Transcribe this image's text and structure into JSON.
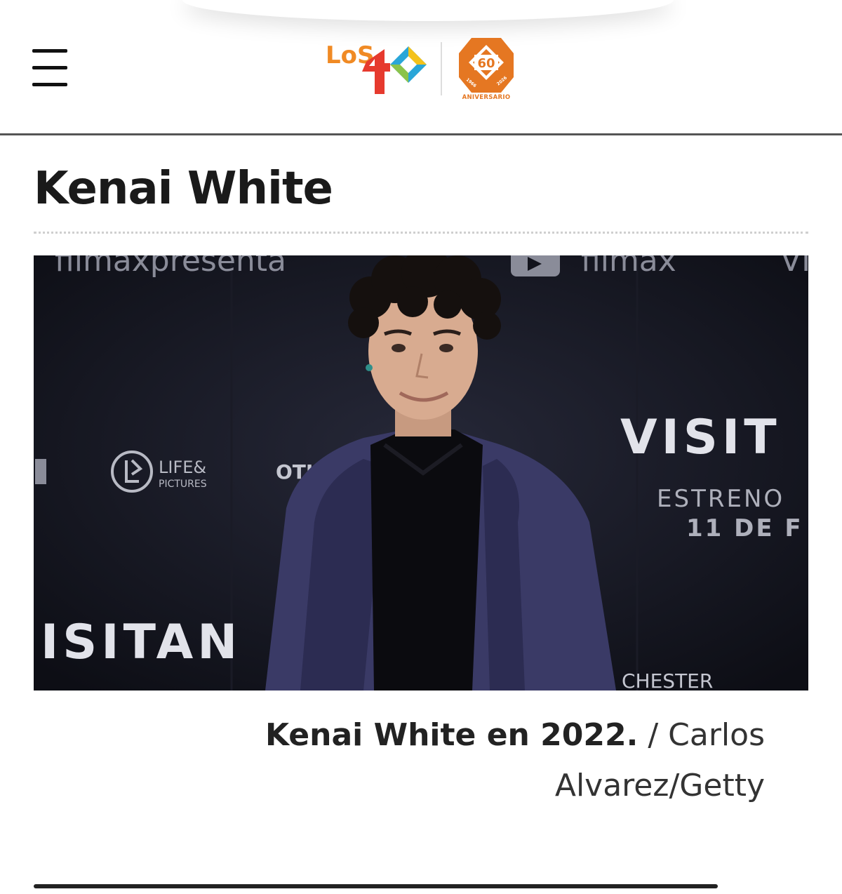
{
  "header": {
    "logo_text": "LOS 40",
    "anniversary": {
      "number": "60",
      "year_start": "1966",
      "year_end": "2026",
      "label": "ANIVERSARIO"
    },
    "menu_icon": "hamburger-menu-icon"
  },
  "article": {
    "title": "Kenai White",
    "image": {
      "backdrop_texts": {
        "top_left": "filmaxpresenta",
        "top_right": "filmax",
        "partial_top_right": "VI",
        "sponsor_1": "LIFE&",
        "sponsor_1_sub": "PICTURES",
        "sponsor_2": "OTH",
        "movie_left": "ISITAN",
        "movie_right": "VISIT",
        "release_1": "ESTRENO",
        "release_2": "11 DE F",
        "sponsor_3": "CHESTER"
      }
    },
    "caption_bold": "Kenai White en 2022.",
    "caption_credit": " / Carlos Alvarez/Getty"
  },
  "colors": {
    "accent": "#e57722",
    "logo_red": "#e63a2e",
    "photo_bg": "#12131c",
    "jacket": "#3a3a66"
  }
}
